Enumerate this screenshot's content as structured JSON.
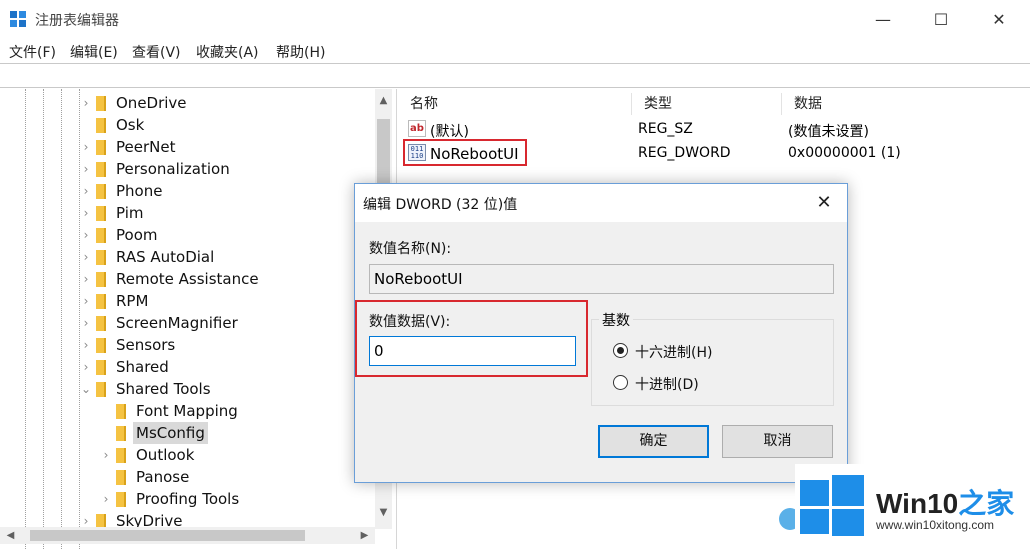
{
  "window": {
    "title": "注册表编辑器",
    "minimize": "—",
    "maximize": "☐",
    "close": "✕"
  },
  "menu": [
    "文件(F)",
    "编辑(E)",
    "查看(V)",
    "收藏夹(A)",
    "帮助(H)"
  ],
  "tree": {
    "items": [
      {
        "label": "OneDrive",
        "chevron": "›"
      },
      {
        "label": "Osk",
        "chevron": ""
      },
      {
        "label": "PeerNet",
        "chevron": "›"
      },
      {
        "label": "Personalization",
        "chevron": "›"
      },
      {
        "label": "Phone",
        "chevron": "›"
      },
      {
        "label": "Pim",
        "chevron": "›"
      },
      {
        "label": "Poom",
        "chevron": "›"
      },
      {
        "label": "RAS AutoDial",
        "chevron": "›"
      },
      {
        "label": "Remote Assistance",
        "chevron": "›"
      },
      {
        "label": "RPM",
        "chevron": "›"
      },
      {
        "label": "ScreenMagnifier",
        "chevron": "›"
      },
      {
        "label": "Sensors",
        "chevron": "›"
      },
      {
        "label": "Shared",
        "chevron": "›"
      },
      {
        "label": "Shared Tools",
        "chevron": "⌄"
      },
      {
        "label": "Font Mapping",
        "chevron": ""
      },
      {
        "label": "MsConfig",
        "chevron": ""
      },
      {
        "label": "Outlook",
        "chevron": "›"
      },
      {
        "label": "Panose",
        "chevron": ""
      },
      {
        "label": "Proofing Tools",
        "chevron": "›"
      },
      {
        "label": "SkyDrive",
        "chevron": "›"
      }
    ]
  },
  "values": {
    "columns": [
      "名称",
      "类型",
      "数据"
    ],
    "rows": [
      {
        "icon": "string-value-icon",
        "icon_text": "ab",
        "name": "(默认)",
        "type": "REG_SZ",
        "data": "(数值未设置)"
      },
      {
        "icon": "binary-value-icon",
        "icon_text": "011 110",
        "name": "NoRebootUI",
        "type": "REG_DWORD",
        "data": "0x00000001 (1)"
      }
    ]
  },
  "dialog": {
    "title": "编辑 DWORD (32 位)值",
    "name_label": "数值名称(N):",
    "name_value": "NoRebootUI",
    "data_label": "数值数据(V):",
    "data_value": "0",
    "base_label": "基数",
    "radio_hex": "十六进制(H)",
    "radio_dec": "十进制(D)",
    "selected_base": "hex",
    "ok": "确定",
    "cancel": "取消",
    "close": "✕"
  },
  "watermark": {
    "brand_a": "Win10",
    "brand_b": "之家",
    "url": "www.win10xitong.com"
  },
  "colors": {
    "accent": "#0078d7",
    "highlight_red": "#d8282f",
    "folder": "#f5c342",
    "logo_blue": "#1e8ee8"
  }
}
